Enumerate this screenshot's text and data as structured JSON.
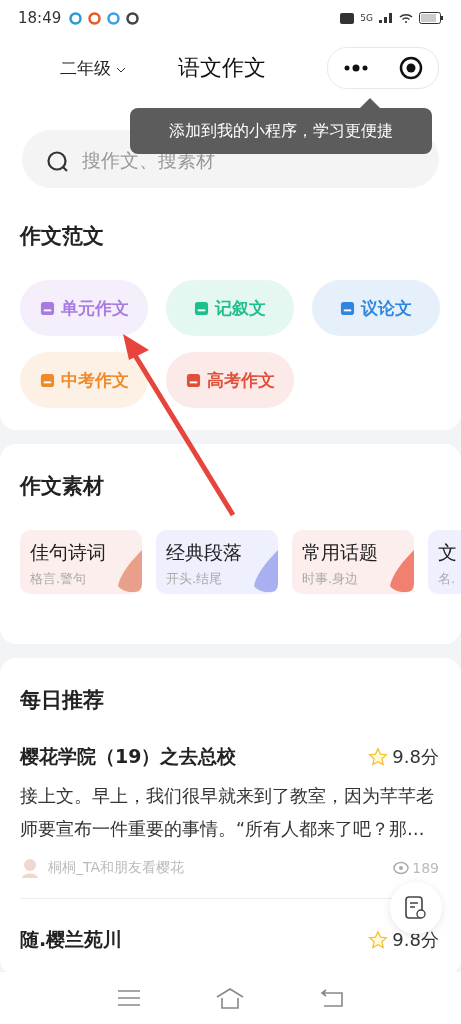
{
  "status_bar": {
    "time": "18:49",
    "network": "5G"
  },
  "header": {
    "grade": "二年级",
    "title": "语文作文"
  },
  "tooltip": {
    "text": "添加到我的小程序，学习更便捷"
  },
  "search": {
    "placeholder": "搜作文、搜素材"
  },
  "sample_section": {
    "title": "作文范文",
    "categories": [
      {
        "label": "单元作文",
        "color": "#a87be0"
      },
      {
        "label": "记叙文",
        "color": "#1fbf8f"
      },
      {
        "label": "议论文",
        "color": "#2f86e0"
      },
      {
        "label": "中考作文",
        "color": "#ee8a2a"
      },
      {
        "label": "高考作文",
        "color": "#e0503a"
      }
    ]
  },
  "material_section": {
    "title": "作文素材",
    "cards": [
      {
        "title": "佳句诗词",
        "subtitle": "格言.警句",
        "color": "#fdeeee"
      },
      {
        "title": "经典段落",
        "subtitle": "开头.结尾",
        "color": "#eef0fd"
      },
      {
        "title": "常用话题",
        "subtitle": "时事.身边",
        "color": "#fdeeee"
      },
      {
        "title": "文",
        "subtitle": "名.",
        "color": "#eef0fd"
      }
    ]
  },
  "daily_section": {
    "title": "每日推荐",
    "articles": [
      {
        "title": "樱花学院（19）之去总校",
        "score": "9.8分",
        "excerpt": "接上文。早上，我们很早就来到了教室，因为芊芊老师要宣布一件重要的事情。“所有人都来了吧？那…",
        "author": "桐桐_TA和朋友看樱花",
        "views": "189"
      },
      {
        "title": "随.樱兰苑川",
        "score": "9.8分"
      }
    ]
  }
}
